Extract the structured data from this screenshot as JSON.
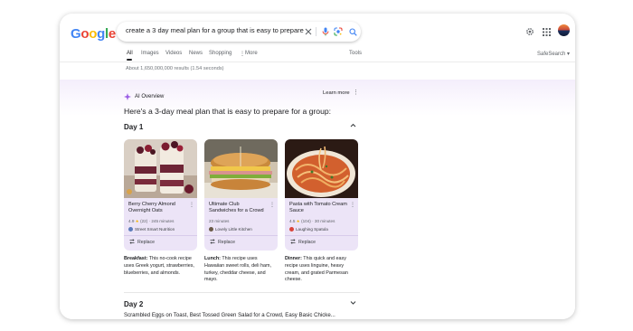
{
  "header": {
    "logo": [
      "G",
      "o",
      "o",
      "g",
      "l",
      "e"
    ],
    "logo_colors": [
      "#4285f4",
      "#ea4335",
      "#fbbc05",
      "#4285f4",
      "#34a853",
      "#ea4335"
    ],
    "search_query": "create a 3 day meal plan for a group that is easy to prepare"
  },
  "tabs": [
    {
      "label": "All",
      "active": true
    },
    {
      "label": "Images"
    },
    {
      "label": "Videos"
    },
    {
      "label": "News"
    },
    {
      "label": "Shopping"
    },
    {
      "label": "More"
    }
  ],
  "tools_label": "Tools",
  "safesearch_label": "SafeSearch",
  "results_count": "About 1,650,000,000 results (1.54 seconds)",
  "ai_overview": {
    "title": "AI Overview",
    "learn_more": "Learn more",
    "heading": "Here's a 3-day meal plan that is easy to prepare for a group:"
  },
  "day1": {
    "title": "Day 1",
    "cards": [
      {
        "title": "Berry Cherry Almond Overnight Oats",
        "rating": "4.9",
        "reviews": "(22)",
        "time": "245 minutes",
        "source": "Street Smart Nutrition",
        "replace": "Replace",
        "desc_label": "Breakfast:",
        "desc": "This no-cook recipe uses Greek yogurt, strawberries, blueberries, and almonds."
      },
      {
        "title": "Ultimate Club Sandwiches for a Crowd",
        "time": "23 minutes",
        "source": "Lovely Little Kitchen",
        "replace": "Replace",
        "desc_label": "Lunch:",
        "desc": "This recipe uses Hawaiian sweet rolls, deli ham, turkey, cheddar cheese, and mayo."
      },
      {
        "title": "Pasta with Tomato Cream Sauce",
        "rating": "4.5",
        "reviews": "(104)",
        "time": "30 minutes",
        "source": "Laughing Spatula",
        "replace": "Replace",
        "desc_label": "Dinner:",
        "desc": "This quick and easy recipe uses linguine, heavy cream, and grated Parmesan cheese."
      }
    ]
  },
  "day2": {
    "title": "Day 2",
    "summary": "Scrambled Eggs on Toast, Best Tossed Green Salad for a Crowd, Easy Basic Chicke..."
  },
  "colors": {
    "card_bg": "#ece4f7",
    "ai_accent": "#9b5de5"
  }
}
